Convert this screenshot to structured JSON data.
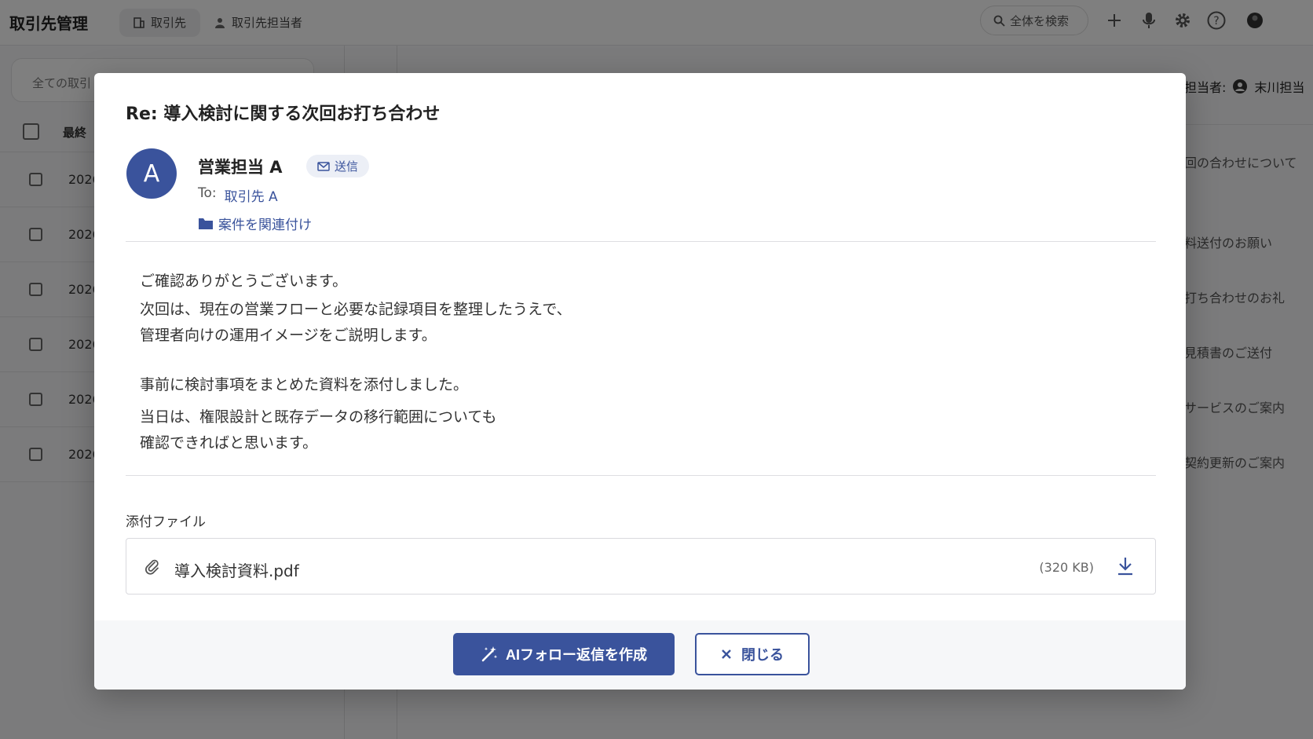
{
  "app": {
    "title": "取引先管理",
    "tabs": [
      {
        "label": "取引先",
        "icon": "building-icon",
        "active": true
      },
      {
        "label": "取引先担当者",
        "icon": "person-icon",
        "active": false
      }
    ],
    "search_placeholder": "全体を検索",
    "icons": [
      "plus-icon",
      "mic-icon",
      "gear-icon",
      "help-icon",
      "avatar-icon"
    ]
  },
  "list": {
    "filter_text": "全ての取引",
    "header_label": "最終",
    "rows": [
      "2026",
      "2026",
      "2026",
      "2026",
      "2026",
      "2026"
    ]
  },
  "right_panel": {
    "header_prefix": "担当者:",
    "owner": "末川担当",
    "subjects": [
      "回の合わせについて",
      "料送付のお願い",
      "打ち合わせのお礼",
      "見積書のご送付",
      "サービスのご案内",
      "契約更新のご案内"
    ]
  },
  "modal": {
    "title": "Re: 導入検討に関する次回お打ち合わせ",
    "avatar_initial": "A",
    "sender": "営業担当 A",
    "badge": "送信",
    "to_label": "To:",
    "to_value": "取引先 A",
    "relate_label": "案件を関連付け",
    "body": [
      "ご確認ありがとうございます。",
      "次回は、現在の営業フローと必要な記録項目を整理したうえで、",
      "管理者向けの運用イメージをご説明します。",
      "事前に検討事項をまとめた資料を添付しました。",
      "当日は、権限設計と既存データの移行範囲についても",
      "確認できればと思います。"
    ],
    "attachments_label": "添付ファイル",
    "attachment": {
      "name": "導入検討資料.pdf",
      "size": "(320 KB)"
    },
    "primary_button": "AIフォロー返信を作成",
    "close_button": "閉じる"
  },
  "colors": {
    "accent": "#3a539c",
    "badge_bg": "#eceff6",
    "overlay": "rgba(0,0,0,0.5)"
  }
}
